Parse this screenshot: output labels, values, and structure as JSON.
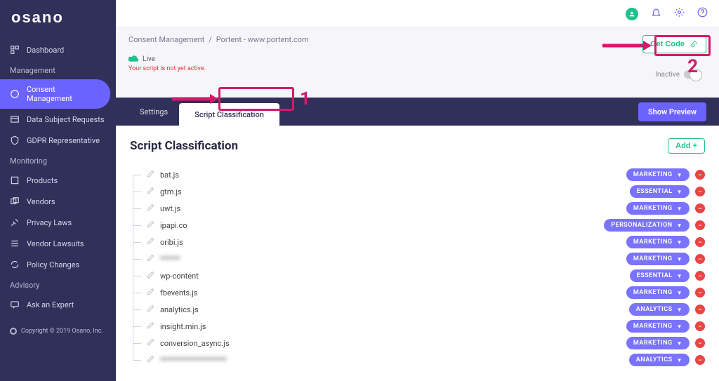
{
  "brand": "osano",
  "sidebar": {
    "items": [
      {
        "label": "Dashboard"
      }
    ],
    "sections": [
      {
        "title": "Management",
        "items": [
          {
            "label": "Consent Management",
            "active": true
          },
          {
            "label": "Data Subject Requests"
          },
          {
            "label": "GDPR Representative"
          }
        ]
      },
      {
        "title": "Monitoring",
        "items": [
          {
            "label": "Products"
          },
          {
            "label": "Vendors"
          },
          {
            "label": "Privacy Laws"
          },
          {
            "label": "Vendor Lawsuits"
          },
          {
            "label": "Policy Changes"
          }
        ]
      },
      {
        "title": "Advisory",
        "items": [
          {
            "label": "Ask an Expert"
          }
        ]
      }
    ],
    "copyright": "Copyright © 2019 Osano, Inc."
  },
  "breadcrumb": {
    "root": "Consent Management",
    "sep": "/",
    "current": "Portent - www.portent.com"
  },
  "status": {
    "live": "Live",
    "warning": "Your script is not yet active.",
    "inactive_label": "Inactive"
  },
  "actions": {
    "get_code": "Get Code",
    "add": "Add +",
    "show_preview": "Show Preview"
  },
  "tabs": {
    "settings": "Settings",
    "script_classification": "Script Classification"
  },
  "panel": {
    "title": "Script Classification"
  },
  "scripts": [
    {
      "name": "bat.js",
      "category": "MARKETING"
    },
    {
      "name": "gtm.js",
      "category": "ESSENTIAL"
    },
    {
      "name": "uwt.js",
      "category": "MARKETING"
    },
    {
      "name": "ipapi.co",
      "category": "PERSONALIZATION"
    },
    {
      "name": "oribi.js",
      "category": "MARKETING"
    },
    {
      "name": "******",
      "category": "MARKETING",
      "blur": true
    },
    {
      "name": "wp-content",
      "category": "ESSENTIAL"
    },
    {
      "name": "fbevents.js",
      "category": "MARKETING"
    },
    {
      "name": "analytics.js",
      "category": "ANALYTICS"
    },
    {
      "name": "insight.min.js",
      "category": "MARKETING"
    },
    {
      "name": "conversion_async.js",
      "category": "MARKETING"
    },
    {
      "name": "********************",
      "category": "ANALYTICS",
      "blur": true
    }
  ],
  "annotations": {
    "num1": "1",
    "num2": "2"
  }
}
